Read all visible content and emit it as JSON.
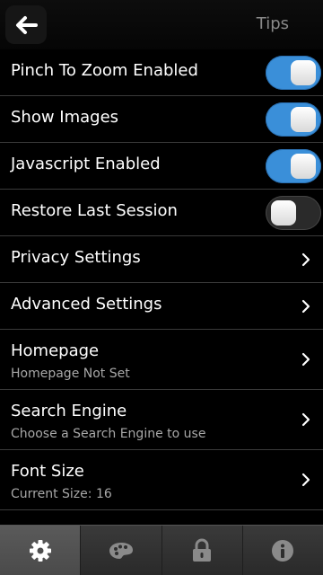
{
  "header": {
    "back_icon": "back-arrow-icon",
    "tips_label": "Tips"
  },
  "settings": [
    {
      "title": "Pinch To Zoom Enabled",
      "type": "toggle",
      "on": true
    },
    {
      "title": "Show Images",
      "type": "toggle",
      "on": true
    },
    {
      "title": "Javascript Enabled",
      "type": "toggle",
      "on": true
    },
    {
      "title": "Restore Last Session",
      "type": "toggle",
      "on": false
    },
    {
      "title": "Privacy Settings",
      "type": "link"
    },
    {
      "title": "Advanced Settings",
      "type": "link"
    },
    {
      "title": "Homepage",
      "subtitle": "Homepage Not Set",
      "type": "link"
    },
    {
      "title": "Search Engine",
      "subtitle": "Choose a Search Engine to use",
      "type": "link"
    },
    {
      "title": "Font Size",
      "subtitle": "Current Size: 16",
      "type": "link"
    }
  ],
  "tabs": [
    {
      "icon": "gear-icon",
      "active": true
    },
    {
      "icon": "palette-icon",
      "active": false
    },
    {
      "icon": "lock-icon",
      "active": false
    },
    {
      "icon": "info-icon",
      "active": false
    }
  ],
  "colors": {
    "toggle_on": "#3a8fd9",
    "background": "#000000",
    "tips_text": "#8a8a8a"
  }
}
